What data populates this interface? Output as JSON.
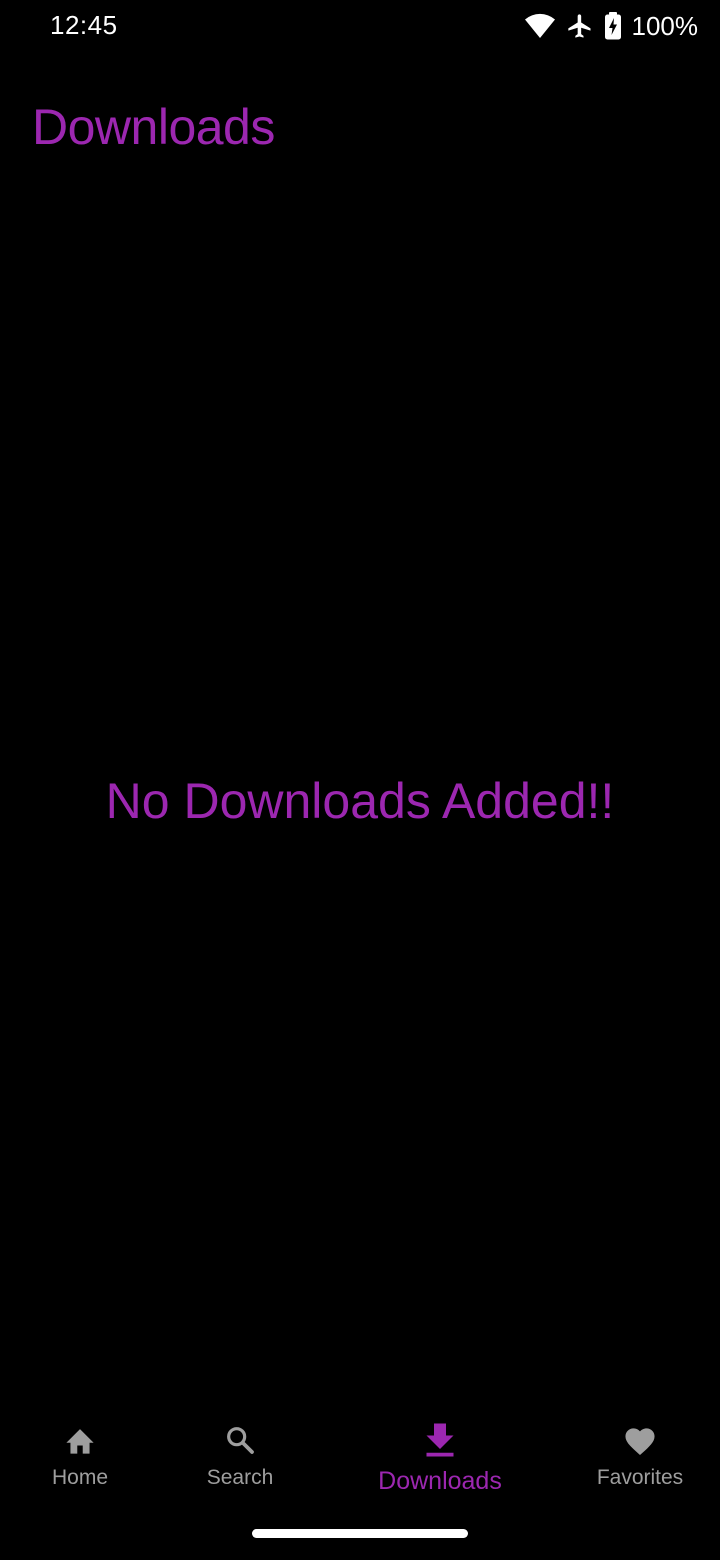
{
  "status_bar": {
    "time": "12:45",
    "battery_percent": "100%",
    "icons": [
      "wifi-icon",
      "airplane-icon",
      "battery-charging-icon"
    ]
  },
  "header": {
    "title": "Downloads"
  },
  "main": {
    "empty_message": "No Downloads Added!!"
  },
  "bottom_nav": {
    "items": [
      {
        "label": "Home",
        "icon": "home-icon",
        "active": false
      },
      {
        "label": "Search",
        "icon": "search-icon",
        "active": false
      },
      {
        "label": "Downloads",
        "icon": "download-icon",
        "active": true
      },
      {
        "label": "Favorites",
        "icon": "heart-icon",
        "active": false
      }
    ]
  },
  "colors": {
    "accent": "#9c27b0",
    "inactive": "#9e9e9e",
    "background": "#000000"
  }
}
